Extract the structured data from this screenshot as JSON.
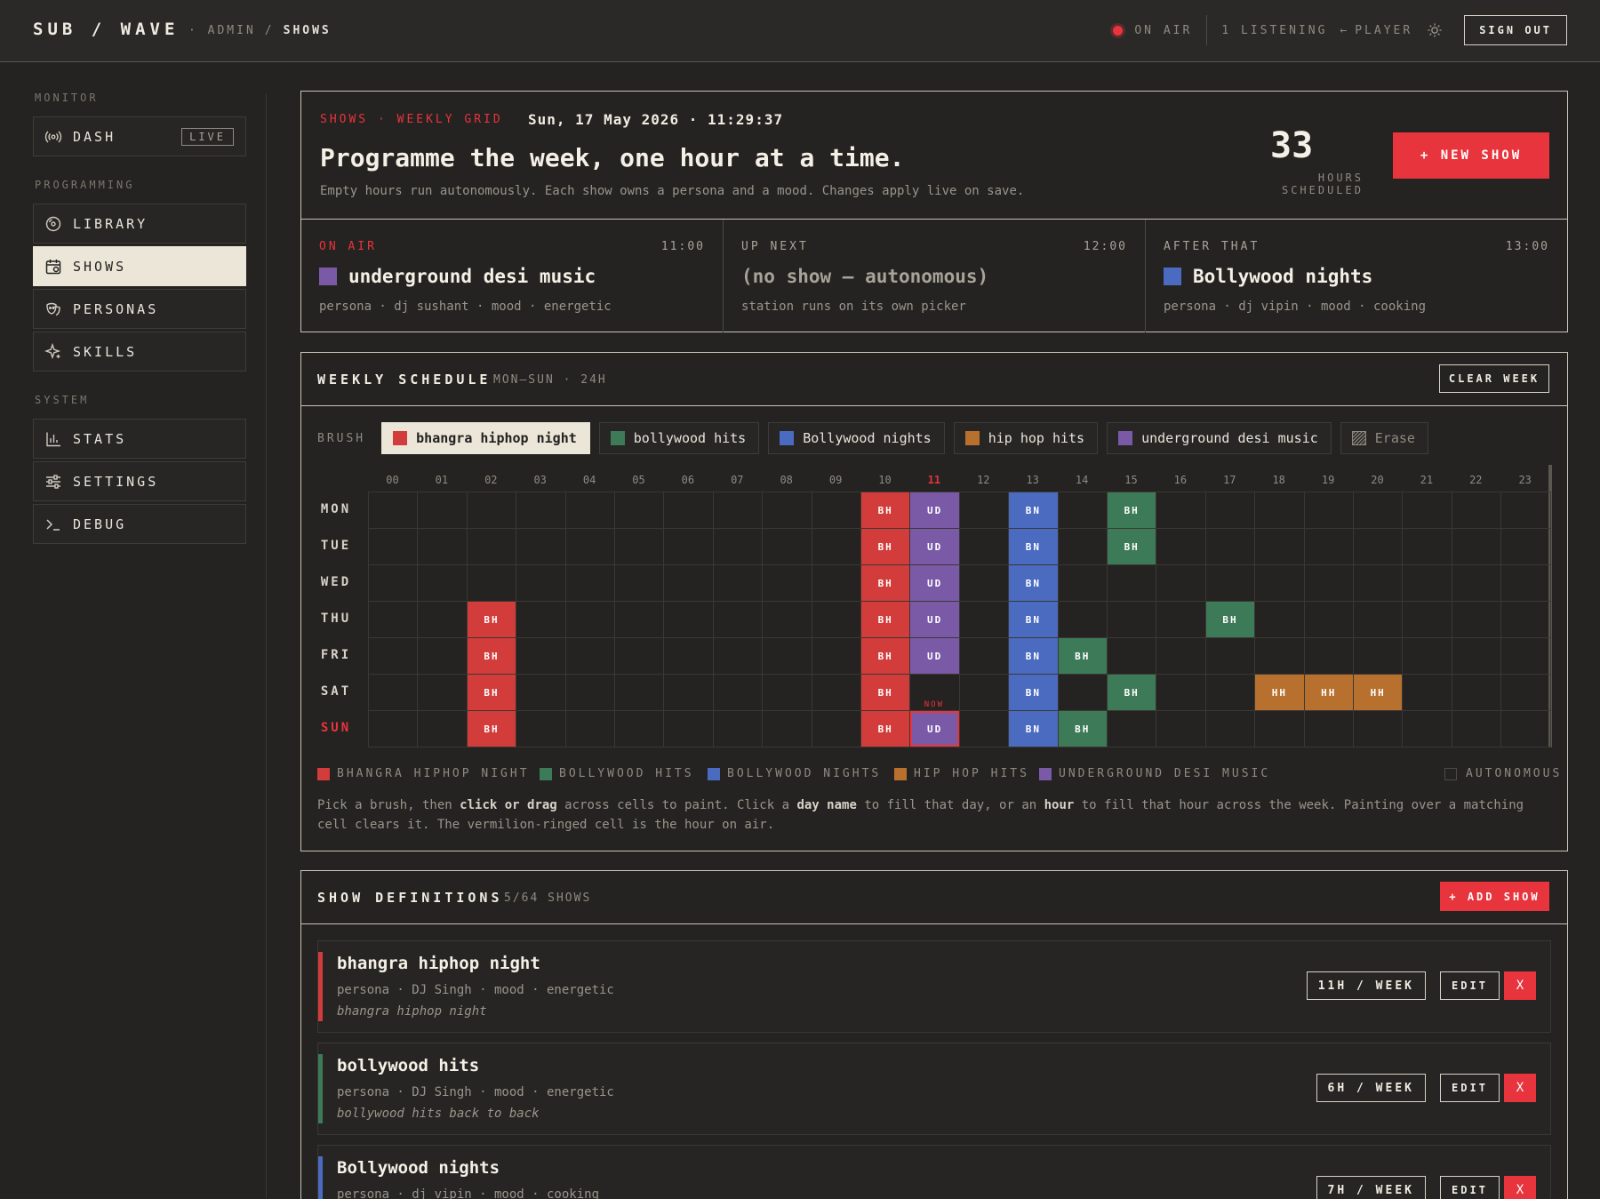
{
  "app": {
    "brand": "SUB / WAVE",
    "crumb_root": "· ADMIN",
    "crumb_sep": "/",
    "crumb_current": "SHOWS",
    "on_air_label": "ON AIR",
    "listening": "1 LISTENING",
    "player_arrow": "←",
    "player_label": "PLAYER",
    "sign_out": "SIGN OUT"
  },
  "sidebar": {
    "sections": [
      "MONITOR",
      "PROGRAMMING",
      "SYSTEM"
    ],
    "items": [
      {
        "label": "DASH",
        "icon": "broadcast-icon"
      },
      {
        "label": "LIBRARY",
        "icon": "disc-icon"
      },
      {
        "label": "SHOWS",
        "icon": "calendar-icon"
      },
      {
        "label": "PERSONAS",
        "icon": "mask-icon"
      },
      {
        "label": "SKILLS",
        "icon": "sparkle-icon"
      },
      {
        "label": "STATS",
        "icon": "bar-chart-icon"
      },
      {
        "label": "SETTINGS",
        "icon": "sliders-icon"
      },
      {
        "label": "DEBUG",
        "icon": "terminal-icon"
      }
    ],
    "live_badge": "LIVE"
  },
  "hero": {
    "kicker": "SHOWS · WEEKLY GRID",
    "date": "Sun, 17 May 2026 · 11:29:37",
    "title": "Programme the week, one hour at a time.",
    "subtitle": "Empty hours run autonomously. Each show owns a persona and a mood. Changes apply live on save.",
    "hours_count": "33",
    "hours_label": "HOURS SCHEDULED",
    "new_show": "+ NEW SHOW"
  },
  "slots": [
    {
      "label": "ON AIR",
      "time": "11:00",
      "title": "underground desi music",
      "meta": "persona · dj sushant · mood · energetic",
      "color": "#7a5aa6"
    },
    {
      "label": "UP NEXT",
      "time": "12:00",
      "title": "(no show — autonomous)",
      "meta": "station runs on its own picker",
      "color": ""
    },
    {
      "label": "AFTER THAT",
      "time": "13:00",
      "title": "Bollywood nights",
      "meta": "persona · dj vipin · mood · cooking",
      "color": "#4a6bbf"
    }
  ],
  "schedule": {
    "title": "WEEKLY SCHEDULE",
    "subtitle": "MON–SUN · 24H",
    "clear_week": "CLEAR WEEK",
    "brush_label": "BRUSH",
    "brushes": [
      {
        "name": "bhangra hiphop night",
        "color": "#d23c3a"
      },
      {
        "name": "bollywood hits",
        "color": "#3c7a58"
      },
      {
        "name": "Bollywood nights",
        "color": "#4a6bbf"
      },
      {
        "name": "hip hop hits",
        "color": "#b8702e"
      },
      {
        "name": "underground desi music",
        "color": "#7a5aa6"
      }
    ],
    "erase": "Erase",
    "hours": [
      "00",
      "01",
      "02",
      "03",
      "04",
      "05",
      "06",
      "07",
      "08",
      "09",
      "10",
      "11",
      "12",
      "13",
      "14",
      "15",
      "16",
      "17",
      "18",
      "19",
      "20",
      "21",
      "22",
      "23"
    ],
    "current_hour": 11,
    "days": [
      "MON",
      "TUE",
      "WED",
      "THU",
      "FRI",
      "SAT",
      "SUN"
    ],
    "current_day": 6,
    "now_label": "NOW",
    "codes": {
      "BH": "#d23c3a",
      "UD": "#7a5aa6",
      "BN": "#4a6bbf",
      "BHG": "#3c7a58",
      "HH": "#b8702e"
    },
    "blocks": [
      {
        "day": 0,
        "hour": 10,
        "code": "BH",
        "color": "#d23c3a"
      },
      {
        "day": 0,
        "hour": 11,
        "code": "UD",
        "color": "#7a5aa6"
      },
      {
        "day": 0,
        "hour": 13,
        "code": "BN",
        "color": "#4a6bbf"
      },
      {
        "day": 0,
        "hour": 15,
        "code": "BH",
        "color": "#3c7a58"
      },
      {
        "day": 1,
        "hour": 10,
        "code": "BH",
        "color": "#d23c3a"
      },
      {
        "day": 1,
        "hour": 11,
        "code": "UD",
        "color": "#7a5aa6"
      },
      {
        "day": 1,
        "hour": 13,
        "code": "BN",
        "color": "#4a6bbf"
      },
      {
        "day": 1,
        "hour": 15,
        "code": "BH",
        "color": "#3c7a58"
      },
      {
        "day": 2,
        "hour": 10,
        "code": "BH",
        "color": "#d23c3a"
      },
      {
        "day": 2,
        "hour": 11,
        "code": "UD",
        "color": "#7a5aa6"
      },
      {
        "day": 2,
        "hour": 13,
        "code": "BN",
        "color": "#4a6bbf"
      },
      {
        "day": 3,
        "hour": 2,
        "code": "BH",
        "color": "#d23c3a"
      },
      {
        "day": 3,
        "hour": 10,
        "code": "BH",
        "color": "#d23c3a"
      },
      {
        "day": 3,
        "hour": 11,
        "code": "UD",
        "color": "#7a5aa6"
      },
      {
        "day": 3,
        "hour": 13,
        "code": "BN",
        "color": "#4a6bbf"
      },
      {
        "day": 3,
        "hour": 17,
        "code": "BH",
        "color": "#3c7a58"
      },
      {
        "day": 4,
        "hour": 2,
        "code": "BH",
        "color": "#d23c3a"
      },
      {
        "day": 4,
        "hour": 10,
        "code": "BH",
        "color": "#d23c3a"
      },
      {
        "day": 4,
        "hour": 11,
        "code": "UD",
        "color": "#7a5aa6"
      },
      {
        "day": 4,
        "hour": 13,
        "code": "BN",
        "color": "#4a6bbf"
      },
      {
        "day": 4,
        "hour": 14,
        "code": "BH",
        "color": "#3c7a58"
      },
      {
        "day": 5,
        "hour": 2,
        "code": "BH",
        "color": "#d23c3a"
      },
      {
        "day": 5,
        "hour": 10,
        "code": "BH",
        "color": "#d23c3a"
      },
      {
        "day": 5,
        "hour": 13,
        "code": "BN",
        "color": "#4a6bbf"
      },
      {
        "day": 5,
        "hour": 15,
        "code": "BH",
        "color": "#3c7a58"
      },
      {
        "day": 5,
        "hour": 18,
        "code": "HH",
        "color": "#b8702e"
      },
      {
        "day": 5,
        "hour": 19,
        "code": "HH",
        "color": "#b8702e"
      },
      {
        "day": 5,
        "hour": 20,
        "code": "HH",
        "color": "#b8702e"
      },
      {
        "day": 6,
        "hour": 2,
        "code": "BH",
        "color": "#d23c3a"
      },
      {
        "day": 6,
        "hour": 10,
        "code": "BH",
        "color": "#d23c3a"
      },
      {
        "day": 6,
        "hour": 11,
        "code": "UD",
        "color": "#7a5aa6"
      },
      {
        "day": 6,
        "hour": 13,
        "code": "BN",
        "color": "#4a6bbf"
      },
      {
        "day": 6,
        "hour": 14,
        "code": "BH",
        "color": "#3c7a58"
      }
    ],
    "legend": [
      {
        "name": "BHANGRA HIPHOP NIGHT",
        "color": "#d23c3a"
      },
      {
        "name": "BOLLYWOOD HITS",
        "color": "#3c7a58"
      },
      {
        "name": "BOLLYWOOD NIGHTS",
        "color": "#4a6bbf"
      },
      {
        "name": "HIP HOP HITS",
        "color": "#b8702e"
      },
      {
        "name": "UNDERGROUND DESI MUSIC",
        "color": "#7a5aa6"
      }
    ],
    "legend_autonomous": "AUTONOMOUS",
    "help_1": "Pick a brush, then ",
    "help_b1": "click or drag",
    "help_2": " across cells to paint. Click a ",
    "help_b2": "day name",
    "help_3": " to fill that day, or an ",
    "help_b3": "hour",
    "help_4": " to fill that hour across the week. Painting over a matching cell clears it. The vermilion-ringed cell is the hour on air."
  },
  "definitions": {
    "title": "SHOW DEFINITIONS",
    "count": "5/64 SHOWS",
    "add_show": "+ ADD SHOW",
    "edit_label": "EDIT",
    "delete_label": "X",
    "shows": [
      {
        "name": "bhangra hiphop night",
        "meta": "persona · DJ Singh · mood · energetic",
        "desc": "bhangra hiphop night",
        "hours": "11H / WEEK",
        "color": "#d23c3a"
      },
      {
        "name": "bollywood hits",
        "meta": "persona · DJ Singh · mood · energetic",
        "desc": "bollywood hits back to back",
        "hours": "6H / WEEK",
        "color": "#3c7a58"
      },
      {
        "name": "Bollywood nights",
        "meta": "persona · dj vipin · mood · cooking",
        "desc": "",
        "hours": "7H / WEEK",
        "color": "#4a6bbf"
      }
    ]
  }
}
